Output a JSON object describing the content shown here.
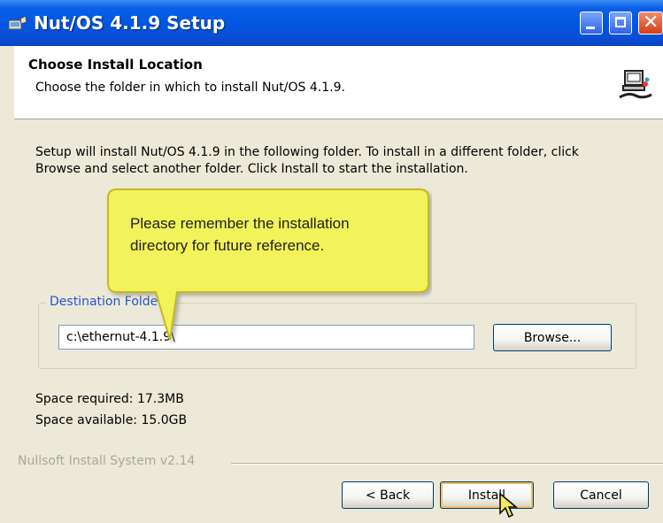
{
  "window": {
    "title": "Nut/OS 4.1.9 Setup",
    "icon": "installer-icon",
    "controls": {
      "minimize": "minimize-icon",
      "maximize": "maximize-icon",
      "close": "✕"
    }
  },
  "header": {
    "title": "Choose Install Location",
    "subtitle": "Choose the folder in which to install Nut/OS 4.1.9.",
    "icon": "computer-install-icon"
  },
  "body": {
    "intro_line1": "Setup will install Nut/OS 4.1.9 in the following folder. To install in a different folder, click",
    "intro_line2": "Browse and select another folder. Click Install to start the installation.",
    "destination_label": "Destination Folder",
    "destination_value": "c:\\ethernut-4.1.9\\",
    "browse_label": "Browse...",
    "space_required": "Space required: 17.3MB",
    "space_available": "Space available: 15.0GB"
  },
  "footer": {
    "branding": "Nullsoft Install System v2.14",
    "back_label": "< Back",
    "install_label": "Install",
    "cancel_label": "Cancel"
  },
  "callout": {
    "line1": "Please remember the installation",
    "line2": "directory for future reference.",
    "fill": "#f2f25a",
    "stroke": "#c8b820"
  },
  "colors": {
    "titlebar": "#0054e3",
    "dialog_bg": "#ece9d8",
    "group_label": "#2255cc"
  }
}
